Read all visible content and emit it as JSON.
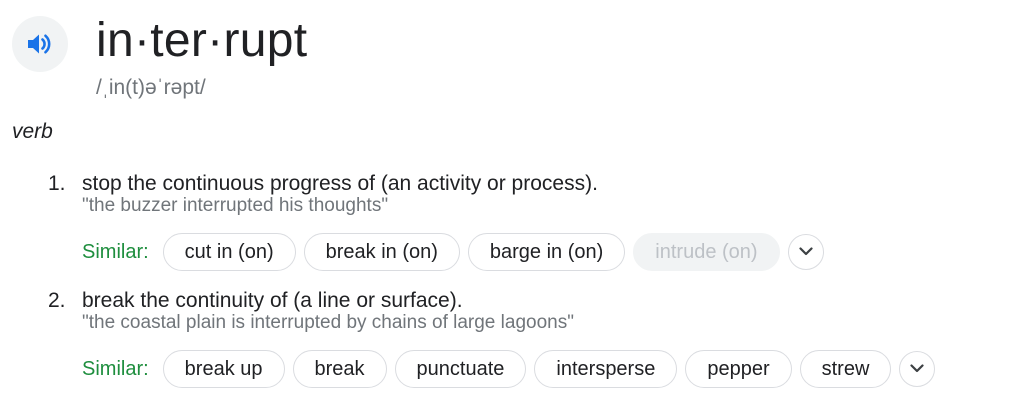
{
  "entry": {
    "word": "in·ter·rupt",
    "phonetic": "/ˌin(t)əˈrəpt/",
    "part_of_speech": "verb",
    "speaker_icon": "volume-icon",
    "senses": [
      {
        "number": "1.",
        "definition": "stop the continuous progress of (an activity or process).",
        "example": "\"the buzzer interrupted his thoughts\"",
        "similar_label": "Similar:",
        "similar": [
          "cut in (on)",
          "break in (on)",
          "barge in (on)",
          "intrude (on)"
        ],
        "faded_chip": "intrude (on)",
        "expand_icon": "chevron-down-icon"
      },
      {
        "number": "2.",
        "definition": "break the continuity of (a line or surface).",
        "example": "\"the coastal plain is interrupted by chains of large lagoons\"",
        "similar_label": "Similar:",
        "similar": [
          "break up",
          "break",
          "punctuate",
          "intersperse",
          "pepper",
          "strew"
        ],
        "expand_icon": "chevron-down-icon"
      }
    ]
  },
  "colors": {
    "similar_label": "#1e8e3e",
    "speaker_icon": "#1a73e8",
    "example_text": "#70757a"
  }
}
